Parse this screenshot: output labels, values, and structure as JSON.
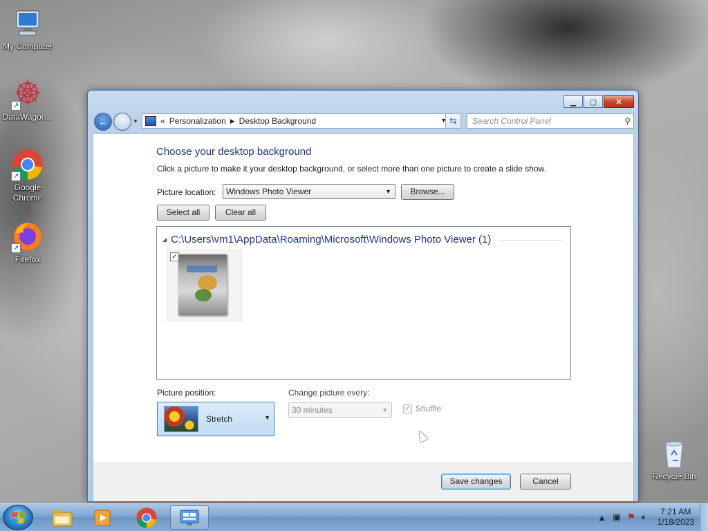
{
  "desktop": {
    "icons": [
      {
        "label": "My Computer"
      },
      {
        "label": "DataWagon..."
      },
      {
        "label": "Google Chrome"
      },
      {
        "label": "Firefox"
      },
      {
        "label": "Recycle Bin"
      }
    ]
  },
  "window": {
    "breadcrumb": [
      "Personalization",
      "Desktop Background"
    ],
    "search_placeholder": "Search Control Panel",
    "title": "Choose your desktop background",
    "subtitle": "Click a picture to make it your desktop background, or select more than one picture to create a slide show.",
    "picture_location_label": "Picture location:",
    "picture_location_value": "Windows Photo Viewer",
    "browse_label": "Browse...",
    "select_all_label": "Select all",
    "clear_all_label": "Clear all",
    "folder_path": "C:\\Users\\vm1\\AppData\\Roaming\\Microsoft\\Windows Photo Viewer (1)",
    "picture_position_label": "Picture position:",
    "picture_position_value": "Stretch",
    "change_picture_label": "Change picture every:",
    "change_picture_value": "30 minutes",
    "shuffle_label": "Shuffle",
    "save_label": "Save changes",
    "cancel_label": "Cancel"
  },
  "taskbar": {
    "time": "7:21 AM",
    "date": "1/18/2023"
  }
}
